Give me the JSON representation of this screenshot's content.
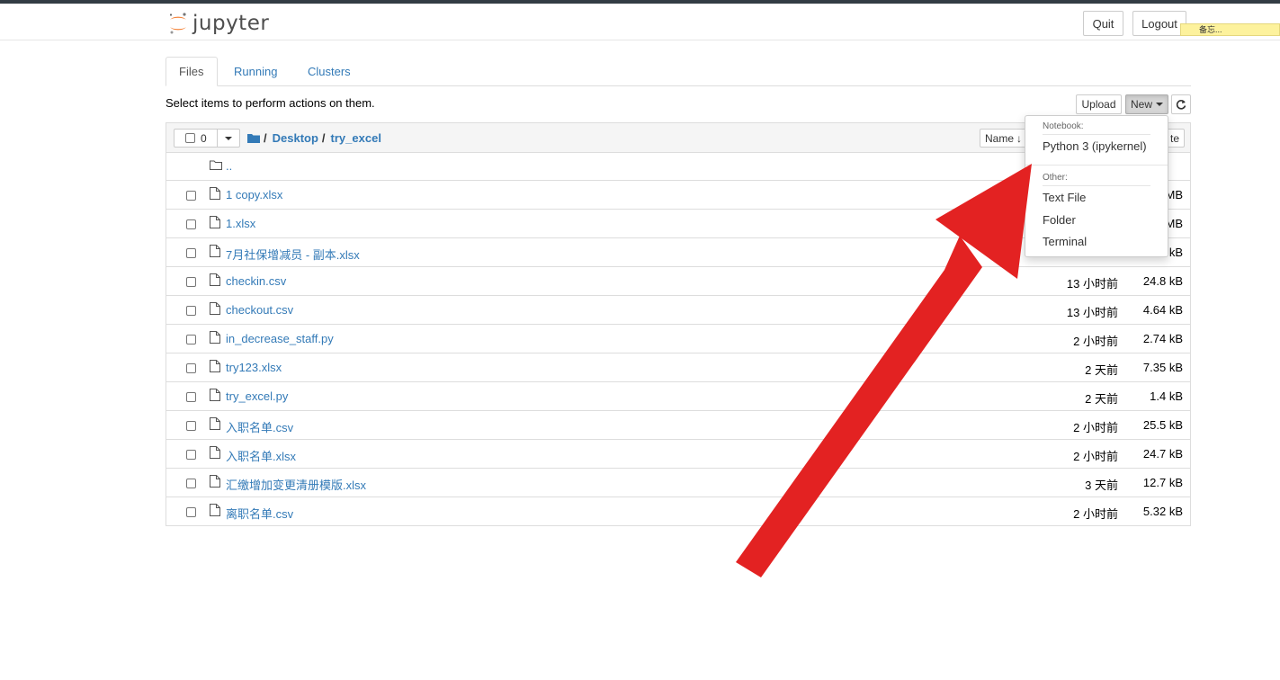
{
  "header": {
    "logo_text": "jupyter",
    "quit_label": "Quit",
    "logout_label": "Logout",
    "note_tag": "备忘..."
  },
  "tabs": [
    {
      "label": "Files",
      "active": true
    },
    {
      "label": "Running",
      "active": false
    },
    {
      "label": "Clusters",
      "active": false
    }
  ],
  "toolbar": {
    "hint": "Select items to perform actions on them.",
    "upload_label": "Upload",
    "new_label": "New",
    "refresh_icon": "refresh-icon"
  },
  "list_header": {
    "selected_count": "0",
    "breadcrumb": [
      "Desktop",
      "try_excel"
    ],
    "root_sep": "/",
    "sort_label": "Name",
    "size_label": "te"
  },
  "parent_dir": "..",
  "files": [
    {
      "name": "1 copy.xlsx",
      "modified": "",
      "size": "MB"
    },
    {
      "name": "1.xlsx",
      "modified": "",
      "size": "MB"
    },
    {
      "name": "7月社保增减员 - 副本.xlsx",
      "modified": "",
      "size": "kB"
    },
    {
      "name": "checkin.csv",
      "modified": "13 小时前",
      "size": "24.8 kB"
    },
    {
      "name": "checkout.csv",
      "modified": "13 小时前",
      "size": "4.64 kB"
    },
    {
      "name": "in_decrease_staff.py",
      "modified": "2 小时前",
      "size": "2.74 kB"
    },
    {
      "name": "try123.xlsx",
      "modified": "2 天前",
      "size": "7.35 kB"
    },
    {
      "name": "try_excel.py",
      "modified": "2 天前",
      "size": "1.4 kB"
    },
    {
      "name": "入职名单.csv",
      "modified": "2 小时前",
      "size": "25.5 kB"
    },
    {
      "name": "入职名单.xlsx",
      "modified": "2 小时前",
      "size": "24.7 kB"
    },
    {
      "name": "汇缴增加变更清册模版.xlsx",
      "modified": "3 天前",
      "size": "12.7 kB"
    },
    {
      "name": "离职名单.csv",
      "modified": "2 小时前",
      "size": "5.32 kB"
    }
  ],
  "new_menu": {
    "notebook_header": "Notebook:",
    "notebook_items": [
      "Python 3 (ipykernel)"
    ],
    "other_header": "Other:",
    "other_items": [
      "Text File",
      "Folder",
      "Terminal"
    ]
  },
  "colors": {
    "link": "#337ab7",
    "annotation_arrow": "#e32222",
    "jupyter_orange": "#f37726"
  }
}
